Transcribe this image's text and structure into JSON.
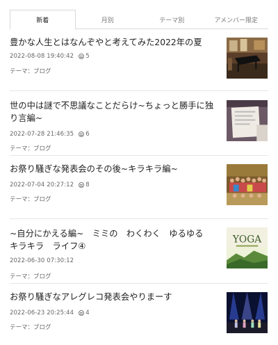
{
  "tabs": [
    {
      "label": "新着"
    },
    {
      "label": "月別"
    },
    {
      "label": "テーマ別"
    },
    {
      "label": "アメンバー限定"
    }
  ],
  "entries": [
    {
      "title": "豊かな人生とはなんぞやと考えてみた2022年の夏",
      "date": "2022-08-08 19:40:42",
      "comments": "5",
      "theme_prefix": "テーマ：",
      "theme": "ブログ"
    },
    {
      "title": "世の中は謎で不思議なことだらけ~ちょっと勝手に独り言編~",
      "date": "2022-07-28 21:46:35",
      "comments": "6",
      "theme_prefix": "テーマ：",
      "theme": "ブログ"
    },
    {
      "title": "お祭り騒ぎな発表会のその後~キラキラ編~",
      "date": "2022-07-04 20:27:12",
      "comments": "8",
      "theme_prefix": "テーマ：",
      "theme": "ブログ"
    },
    {
      "title": "~自分にかえる編~　ミミの　わくわく　ゆるゆる　キラキラ　ライフ④",
      "date": "2022-06-30 07:30:12",
      "comments": "",
      "theme_prefix": "テーマ：",
      "theme": "ブログ"
    },
    {
      "title": "お祭り騒ぎなアレグレコ発表会やりまーす",
      "date": "2022-06-23 20:25:44",
      "comments": "4",
      "theme_prefix": "テーマ：",
      "theme": "ブログ"
    }
  ],
  "thumb_texts": {
    "yoga_word": "YOGA"
  },
  "colors": {
    "accent_border": "#d9d9d9",
    "text": "#222222",
    "meta": "#666666"
  }
}
